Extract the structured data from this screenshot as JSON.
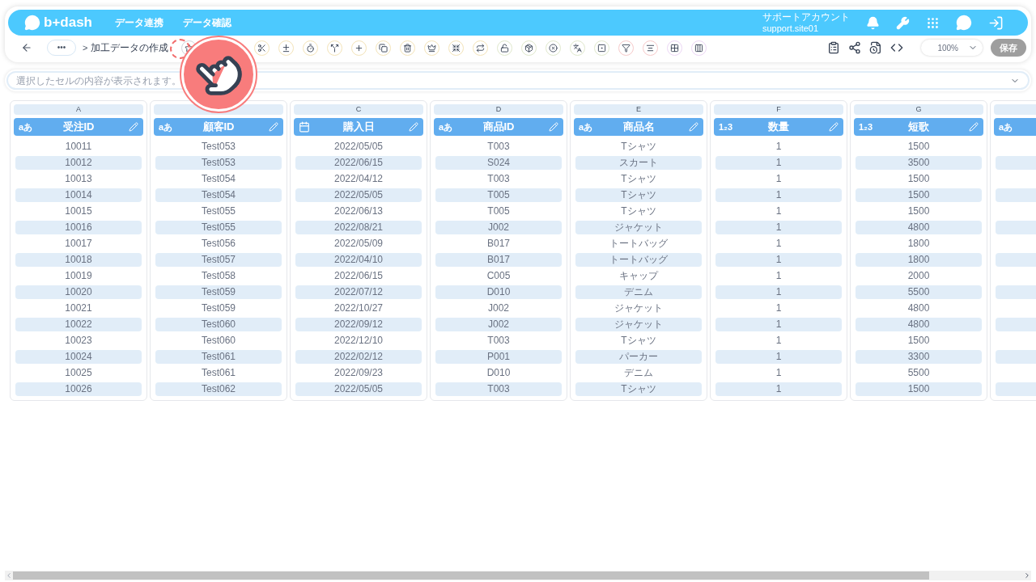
{
  "header": {
    "logo": "b+dash",
    "nav": [
      {
        "label": "データ連携"
      },
      {
        "label": "データ確認"
      }
    ],
    "account": {
      "name": "サポートアカウント",
      "id": "support.site01"
    }
  },
  "toolbar": {
    "menu": "•••",
    "separator": ">",
    "breadcrumb": "加工データの作成",
    "zoom": "100%",
    "save": {
      "label": "保存",
      "disabled": true
    }
  },
  "formula_bar": {
    "placeholder": "選択したセルの内容が表示されます。"
  },
  "columns": [
    {
      "letter": "A",
      "kind": "text",
      "type_mark": "aあ",
      "name": "受注ID",
      "cells": [
        "10011",
        "10012",
        "10013",
        "10014",
        "10015",
        "10016",
        "10017",
        "10018",
        "10019",
        "10020",
        "10021",
        "10022",
        "10023",
        "10024",
        "10025",
        "10026"
      ]
    },
    {
      "kind": "text",
      "type_mark": "aあ",
      "name": "顧客ID",
      "cells": [
        "Test053",
        "Test053",
        "Test054",
        "Test054",
        "Test055",
        "Test055",
        "Test056",
        "Test057",
        "Test058",
        "Test059",
        "Test059",
        "Test060",
        "Test060",
        "Test061",
        "Test061",
        "Test062"
      ]
    },
    {
      "letter": "C",
      "kind": "date",
      "name": "購入日",
      "cells": [
        "2022/05/05",
        "2022/06/15",
        "2022/04/12",
        "2022/05/05",
        "2022/06/13",
        "2022/08/21",
        "2022/05/09",
        "2022/04/10",
        "2022/06/15",
        "2022/07/12",
        "2022/10/27",
        "2022/09/12",
        "2022/12/10",
        "2022/02/12",
        "2022/09/23",
        "2022/05/05"
      ]
    },
    {
      "letter": "D",
      "kind": "text",
      "type_mark": "aあ",
      "name": "商品ID",
      "cells": [
        "T003",
        "S024",
        "T003",
        "T005",
        "T005",
        "J002",
        "B017",
        "B017",
        "C005",
        "D010",
        "J002",
        "J002",
        "T003",
        "P001",
        "D010",
        "T003"
      ]
    },
    {
      "letter": "E",
      "kind": "text",
      "type_mark": "aあ",
      "name": "商品名",
      "cells": [
        "Tシャツ",
        "スカート",
        "Tシャツ",
        "Tシャツ",
        "Tシャツ",
        "ジャケット",
        "トートバッグ",
        "トートバッグ",
        "キャップ",
        "デニム",
        "ジャケット",
        "ジャケット",
        "Tシャツ",
        "パーカー",
        "デニム",
        "Tシャツ"
      ]
    },
    {
      "letter": "F",
      "kind": "number",
      "type_mark": "1₂3",
      "name": "数量",
      "cells": [
        "1",
        "1",
        "1",
        "1",
        "1",
        "1",
        "1",
        "1",
        "1",
        "1",
        "1",
        "1",
        "1",
        "1",
        "1",
        "1"
      ]
    },
    {
      "letter": "G",
      "kind": "number",
      "type_mark": "1₂3",
      "name": "短歌",
      "cells": [
        "1500",
        "3500",
        "1500",
        "1500",
        "1500",
        "4800",
        "1800",
        "1800",
        "2000",
        "5500",
        "4800",
        "4800",
        "1500",
        "3300",
        "5500",
        "1500"
      ]
    },
    {
      "kind": "text",
      "type_mark": "aあ"
    }
  ]
}
